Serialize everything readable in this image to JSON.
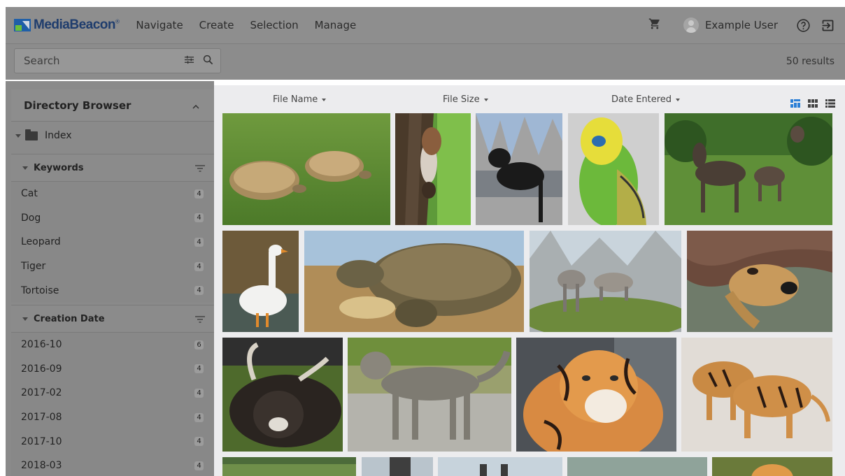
{
  "app": {
    "logo_text": "MediaBeacon",
    "nav": [
      "Navigate",
      "Create",
      "Selection",
      "Manage"
    ],
    "user_name": "Example User",
    "colors": {
      "logo_blue": "#1f5fa8",
      "logo_green": "#6cbf3b",
      "view_active": "#2b7fd6"
    }
  },
  "search": {
    "placeholder": "Search",
    "results": "50 results"
  },
  "sidebar": {
    "directory_title": "Directory Browser",
    "index_label": "Index",
    "keywords": {
      "title": "Keywords",
      "items": [
        {
          "label": "Cat",
          "count": "4"
        },
        {
          "label": "Dog",
          "count": "4"
        },
        {
          "label": "Leopard",
          "count": "4"
        },
        {
          "label": "Tiger",
          "count": "4"
        },
        {
          "label": "Tortoise",
          "count": "4"
        }
      ]
    },
    "creation_date": {
      "title": "Creation Date",
      "items": [
        {
          "label": "2016-10",
          "count": "6"
        },
        {
          "label": "2016-09",
          "count": "4"
        },
        {
          "label": "2017-02",
          "count": "4"
        },
        {
          "label": "2017-08",
          "count": "4"
        },
        {
          "label": "2017-10",
          "count": "4"
        },
        {
          "label": "2018-03",
          "count": "4"
        }
      ]
    }
  },
  "main": {
    "sort": [
      "File Name",
      "File Size",
      "Date Entered"
    ],
    "view_modes": [
      "masonry-view-icon",
      "grid-view-icon",
      "list-view-icon"
    ],
    "thumbnails": [
      "tortoises-on-grass",
      "squirrel-on-tree",
      "black-cat-on-fence",
      "green-budgie",
      "moose-family",
      "white-goose",
      "giant-tortoise",
      "wolves-on-rock",
      "dog-under-blanket",
      "yak-lying",
      "tabby-cat",
      "tiger-portrait",
      "tigers-in-snow",
      "partial-1",
      "partial-2",
      "partial-3",
      "partial-4",
      "partial-5"
    ]
  },
  "icons": [
    "cart-icon",
    "avatar-icon",
    "help-icon",
    "logout-icon",
    "filter-sliders-icon",
    "search-icon",
    "chevron-up-icon",
    "folder-icon",
    "filter-icon"
  ]
}
